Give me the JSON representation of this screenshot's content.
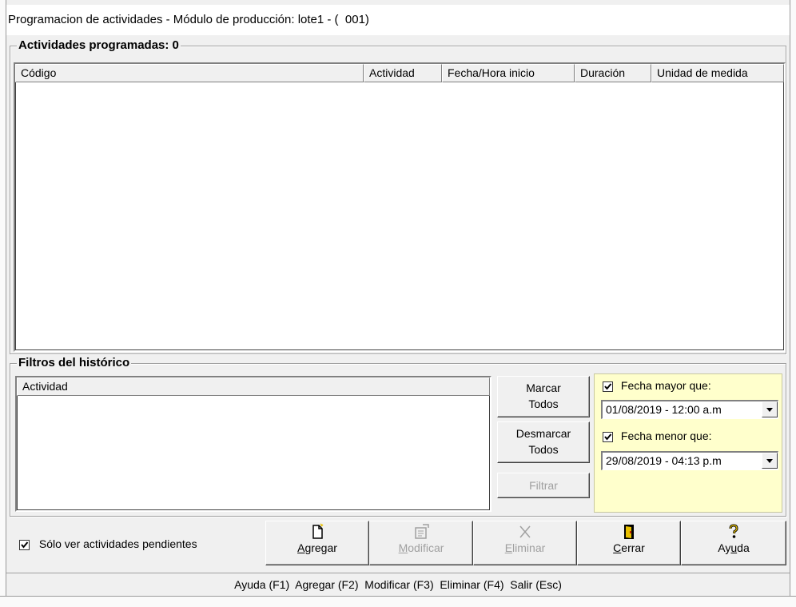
{
  "window": {
    "title": "Programacion de actividades - Módulo de producción: lote1 - (  001)"
  },
  "scheduled": {
    "title": "Actividades programadas: 0",
    "columns": [
      "Código",
      "Actividad",
      "Fecha/Hora inicio",
      "Duración",
      "Unidad de medida"
    ],
    "rows": []
  },
  "filters": {
    "title": "Filtros del histórico",
    "activity_column": "Actividad",
    "mark_all": [
      "Marcar",
      "Todos"
    ],
    "unmark_all": [
      "Desmarcar",
      "Todos"
    ],
    "filter_button": "Filtrar",
    "date_from_label": "Fecha mayor que:",
    "date_from_checked": true,
    "date_from_value": "01/08/2019 - 12:00 a.m",
    "date_to_label": "Fecha menor que:",
    "date_to_checked": true,
    "date_to_value": "29/08/2019 - 04:13 p.m"
  },
  "toolbar": {
    "pending_only_label": "Sólo ver actividades pendientes",
    "pending_only_checked": true,
    "add": {
      "pre": "",
      "key": "A",
      "post": "gregar",
      "enabled": true,
      "icon": "new-document-icon"
    },
    "modify": {
      "pre": "",
      "key": "M",
      "post": "odificar",
      "enabled": false,
      "icon": "edit-document-icon"
    },
    "delete": {
      "pre": "",
      "key": "E",
      "post": "liminar",
      "enabled": false,
      "icon": "x-delete-icon"
    },
    "close": {
      "pre": "",
      "key": "C",
      "post": "errar",
      "enabled": true,
      "icon": "exit-door-icon"
    },
    "help": {
      "pre": "Ay",
      "key": "u",
      "post": "da",
      "enabled": true,
      "icon": "question-icon"
    }
  },
  "statusbar": {
    "text": "Ayuda (F1)  Agregar (F2)  Modificar (F3)  Eliminar (F4)  Salir (Esc)"
  },
  "colors": {
    "filter_panel": "#ffffcc",
    "background": "#f0f0f0"
  }
}
